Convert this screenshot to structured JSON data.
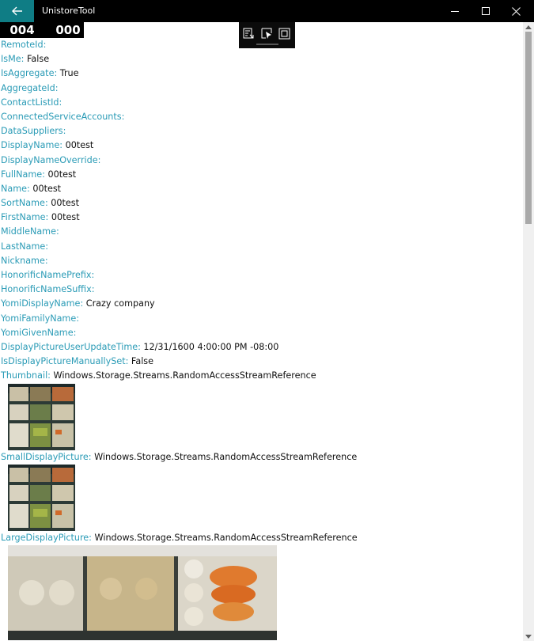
{
  "app": {
    "title": "UnistoreTool"
  },
  "counters": {
    "left": "004",
    "right": "000"
  },
  "properties": [
    {
      "name": "RemoteId:",
      "value": ""
    },
    {
      "name": "IsMe:",
      "value": "False"
    },
    {
      "name": "IsAggregate:",
      "value": "True"
    },
    {
      "name": "AggregateId:",
      "value": ""
    },
    {
      "name": "ContactListId:",
      "value": ""
    },
    {
      "name": "ConnectedServiceAccounts:",
      "value": ""
    },
    {
      "name": "DataSuppliers:",
      "value": ""
    },
    {
      "name": "DisplayName:",
      "value": "00test"
    },
    {
      "name": "DisplayNameOverride:",
      "value": ""
    },
    {
      "name": "FullName:",
      "value": "00test"
    },
    {
      "name": "Name:",
      "value": "00test"
    },
    {
      "name": "SortName:",
      "value": "00test"
    },
    {
      "name": "FirstName:",
      "value": "00test"
    },
    {
      "name": "MiddleName:",
      "value": ""
    },
    {
      "name": "LastName:",
      "value": ""
    },
    {
      "name": "Nickname:",
      "value": ""
    },
    {
      "name": "HonorificNamePrefix:",
      "value": ""
    },
    {
      "name": "HonorificNameSuffix:",
      "value": ""
    },
    {
      "name": "YomiDisplayName:",
      "value": "Crazy company"
    },
    {
      "name": "YomiFamilyName:",
      "value": ""
    },
    {
      "name": "YomiGivenName:",
      "value": ""
    },
    {
      "name": "DisplayPictureUserUpdateTime:",
      "value": "12/31/1600 4:00:00 PM -08:00"
    },
    {
      "name": "IsDisplayPictureManuallySet:",
      "value": "False"
    },
    {
      "name": "Thumbnail:",
      "value": "Windows.Storage.Streams.RandomAccessStreamReference"
    },
    {
      "name": "SmallDisplayPicture:",
      "value": "Windows.Storage.Streams.RandomAccessStreamReference"
    },
    {
      "name": "LargeDisplayPicture:",
      "value": "Windows.Storage.Streams.RandomAccessStreamReference"
    }
  ],
  "icons": {
    "back": "back-arrow-icon",
    "minimize": "minimize-icon",
    "maximize": "maximize-icon",
    "close": "close-icon",
    "tree": "live-visual-tree-icon",
    "select": "select-element-icon",
    "layout": "display-layout-adorners-icon"
  },
  "colors": {
    "accent": "#0f7d85",
    "property_name": "#2a9bb6",
    "titlebar": "#000000"
  }
}
